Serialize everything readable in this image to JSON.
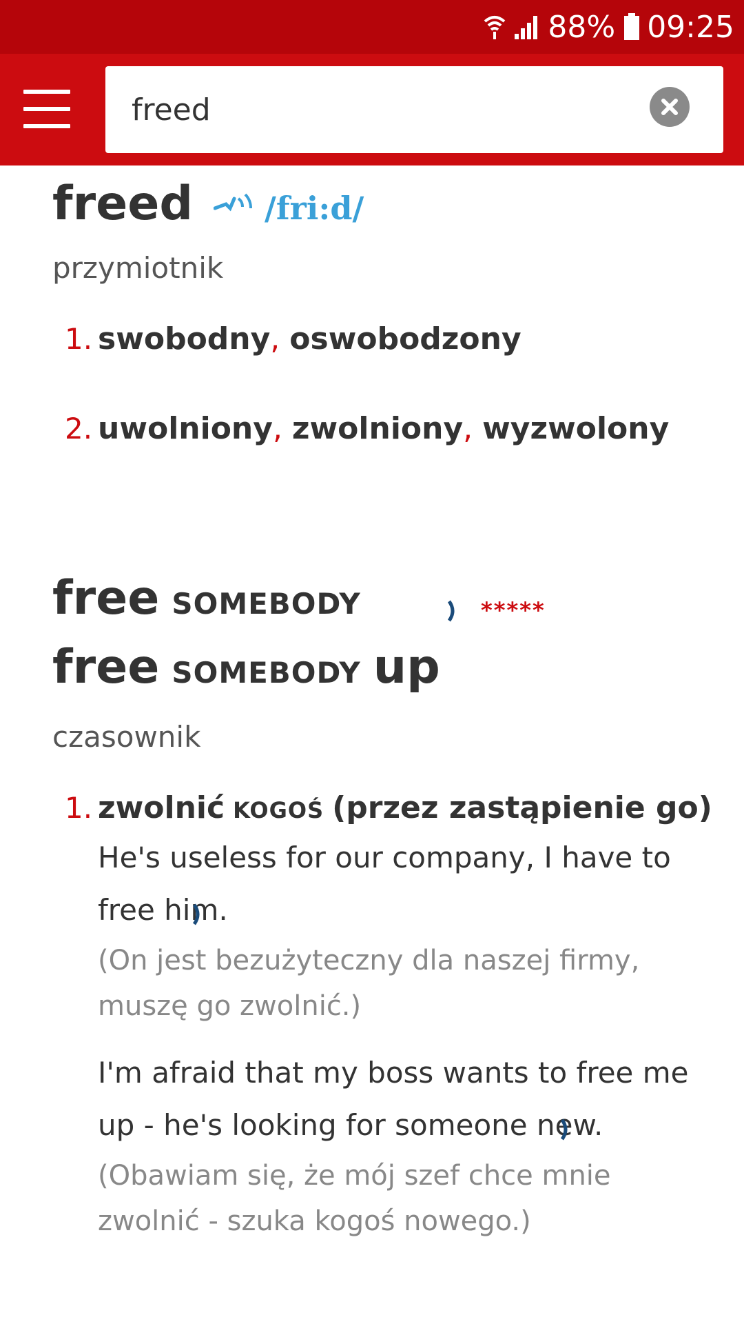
{
  "status_bar": {
    "battery": "88%",
    "time": "09:25",
    "icons": [
      "wifi-icon",
      "signal-icon",
      "battery-icon"
    ]
  },
  "search": {
    "value": "freed",
    "placeholder": ""
  },
  "entry1": {
    "headword": "freed",
    "ipa": "/fri:d/",
    "pos": "przymiotnik",
    "senses": [
      {
        "num": "1.",
        "words": [
          "swobodny",
          "oswobodzony"
        ]
      },
      {
        "num": "2.",
        "words": [
          "uwolniony",
          "zwolniony",
          "wyzwolony"
        ]
      }
    ]
  },
  "entry2": {
    "line1": {
      "main": "free",
      "obj": "SOMEBODY"
    },
    "line2": {
      "main": "free",
      "obj": "SOMEBODY",
      "particle": "up"
    },
    "rating": "*****",
    "pos": "czasownik",
    "sense": {
      "num": "1.",
      "word": "zwolnić",
      "obj": "KOGOŚ",
      "note": "(przez zastąpienie go)",
      "examples": [
        {
          "text": "He's useless for our company, I have to free him.",
          "translation": "(On jest bezużyteczny dla naszej firmy, muszę go zwolnić.)"
        },
        {
          "text": "I'm afraid that my boss wants to free me up - he's looking for someone new.",
          "translation": "(Obawiam się, że mój szef chce mnie zwolnić - szuka kogoś nowego.)"
        }
      ]
    }
  },
  "colors": {
    "status_bar": "#b5050a",
    "app_bar": "#cc0c10",
    "accent": "#cc0c10",
    "ipa": "#3aa0d8",
    "translation": "#888888"
  }
}
